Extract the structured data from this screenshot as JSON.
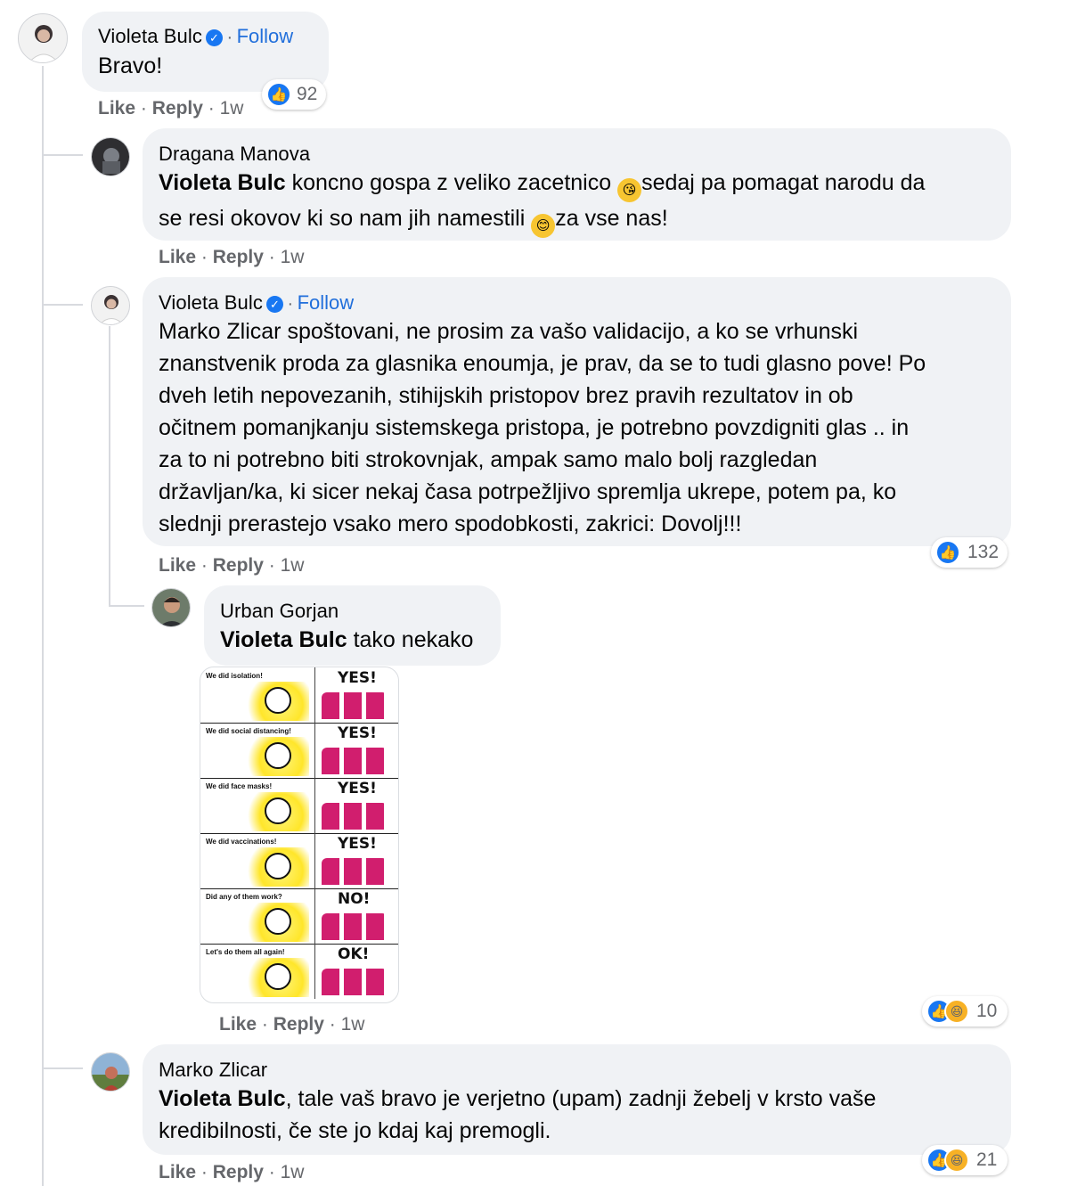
{
  "comments": {
    "c1": {
      "author": "Violeta Bulc",
      "follow": "Follow",
      "separator": "·",
      "text": "Bravo!",
      "actions": {
        "like": "Like",
        "reply": "Reply",
        "sep": "·",
        "time": "1w"
      },
      "reaction_count": "92"
    },
    "c2": {
      "author": "Dragana Manova",
      "mention": "Violeta Bulc",
      "text_a": " koncno gospa z veliko zacetnico ",
      "text_b": "sedaj pa pomagat narodu da",
      "text_c": "se resi okovov ki so nam jih namestili ",
      "text_d": "za vse nas!",
      "actions": {
        "like": "Like",
        "reply": "Reply",
        "sep": "·",
        "time": "1w"
      }
    },
    "c3": {
      "author": "Violeta Bulc",
      "follow": "Follow",
      "separator": "·",
      "lines": [
        "Marko Zlicar spoštovani, ne prosim za vašo validacijo, a ko se vrhunski",
        "znanstvenik proda za glasnika enoumja, je prav, da se to tudi glasno pove! Po",
        "dveh letih nepovezanih, stihijskih pristopov brez pravih rezultatov in ob",
        "očitnem pomanjkanju sistemskega pristopa, je potrebno povzdigniti glas .. in",
        "za to ni potrebno biti strokovnjak, ampak samo malo bolj razgledan",
        "državljan/ka, ki sicer nekaj časa potrpežljivo spremlja ukrepe, potem pa, ko",
        "slednji prerastejo vsako mero spodobkosti, zakrici: Dovolj!!!"
      ],
      "actions": {
        "like": "Like",
        "reply": "Reply",
        "sep": "·",
        "time": "1w"
      },
      "reaction_count": "132"
    },
    "c4": {
      "author": "Urban Gorjan",
      "mention": "Violeta Bulc",
      "text": " tako nekako",
      "meme": {
        "rows": [
          {
            "q": "We did isolation!",
            "a": "YES!"
          },
          {
            "q": "We did social distancing!",
            "a": "YES!"
          },
          {
            "q": "We did face masks!",
            "a": "YES!"
          },
          {
            "q": "We did vaccinations!",
            "a": "YES!"
          },
          {
            "q": "Did any of them work?",
            "a": "NO!"
          },
          {
            "q": "Let's do them all again!",
            "a": "OK!"
          }
        ]
      },
      "actions": {
        "like": "Like",
        "reply": "Reply",
        "sep": "·",
        "time": "1w"
      },
      "reaction_count": "10"
    },
    "c5": {
      "author": "Marko Zlicar",
      "mention": "Violeta Bulc",
      "line1": ", tale vaš bravo je verjetno (upam) zadnji žebelj v krsto vaše",
      "line2": "kredibilnosti, če ste jo kdaj kaj premogli.",
      "actions": {
        "like": "Like",
        "reply": "Reply",
        "sep": "·",
        "time": "1w"
      },
      "reaction_count": "21"
    }
  },
  "icons": {
    "verified": "verified-badge-icon",
    "like": "like-reaction-icon",
    "haha": "haha-reaction-icon",
    "emoji_kiss": "face-blowing-kiss-icon",
    "emoji_smile": "smiling-face-icon"
  },
  "colors": {
    "bubble": "#f0f2f5",
    "link": "#216fdb",
    "like_blue": "#1877f2",
    "muted": "#65676b"
  }
}
